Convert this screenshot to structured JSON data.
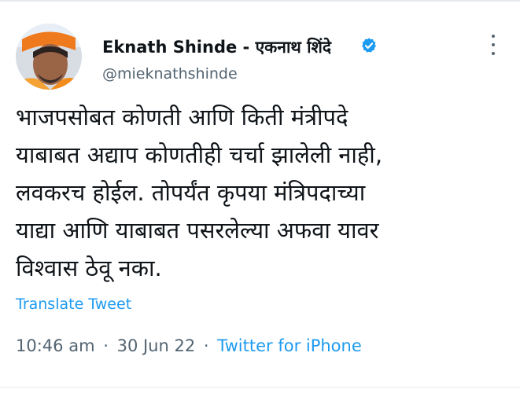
{
  "tweet": {
    "author": {
      "name": "Eknath Shinde - एकनाथ शिंदे",
      "handle": "@mieknathshinde",
      "verified": true
    },
    "text_lines": [
      "भाजपसोबत कोणती आणि किती मंत्रीपदे",
      "याबाबत अद्याप कोणतीही चर्चा झालेली नाही,",
      "लवकरच होईल. तोपर्यंत कृपया मंत्रिपदाच्या",
      "याद्या आणि याबाबत पसरलेल्या अफवा यावर",
      "विश्वास ठेवू नका."
    ],
    "translate_label": "Translate Tweet",
    "meta": {
      "time": "10:46 am",
      "separator": "·",
      "date": "30 Jun 22",
      "source": "Twitter for iPhone"
    }
  },
  "icons": {
    "verified": "verified-badge-icon",
    "more": "more-options-icon"
  },
  "colors": {
    "link": "#1d9bf0",
    "secondary_text": "#536471",
    "primary_text": "#0f1419",
    "divider": "#e7eaee"
  }
}
